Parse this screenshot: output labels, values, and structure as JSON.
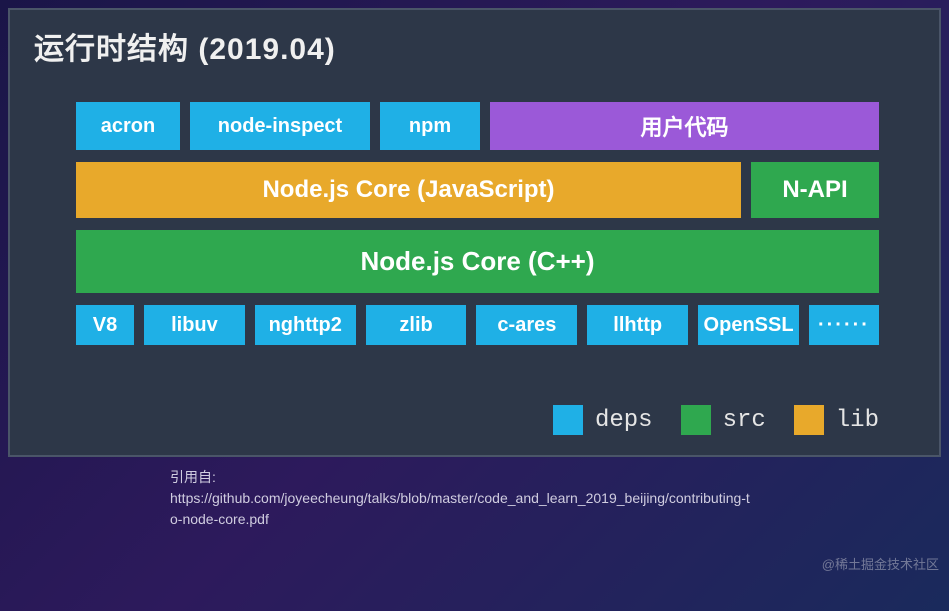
{
  "title": "运行时结构 (2019.04)",
  "row1": {
    "acron": "acron",
    "nodeInspect": "node-inspect",
    "npm": "npm",
    "userCode": "用户代码"
  },
  "row2": {
    "coreJs": "Node.js Core (JavaScript)",
    "napi": "N-API"
  },
  "row3": {
    "coreCpp": "Node.js Core (C++)"
  },
  "row4": {
    "v8": "V8",
    "libuv": "libuv",
    "nghttp2": "nghttp2",
    "zlib": "zlib",
    "cares": "c-ares",
    "llhttp": "llhttp",
    "openssl": "OpenSSL",
    "more": "······"
  },
  "legend": {
    "deps": "deps",
    "src": "src",
    "lib": "lib"
  },
  "citation": {
    "prefix": "引用自:",
    "url": "https://github.com/joyeecheung/talks/blob/master/code_and_learn_2019_beijing/contributing-to-node-core.pdf"
  },
  "watermark": "@稀土掘金技术社区",
  "colors": {
    "dep": "#1fb0e6",
    "src": "#2fa84f",
    "lib": "#e8a92b",
    "user": "#9b59d8"
  }
}
